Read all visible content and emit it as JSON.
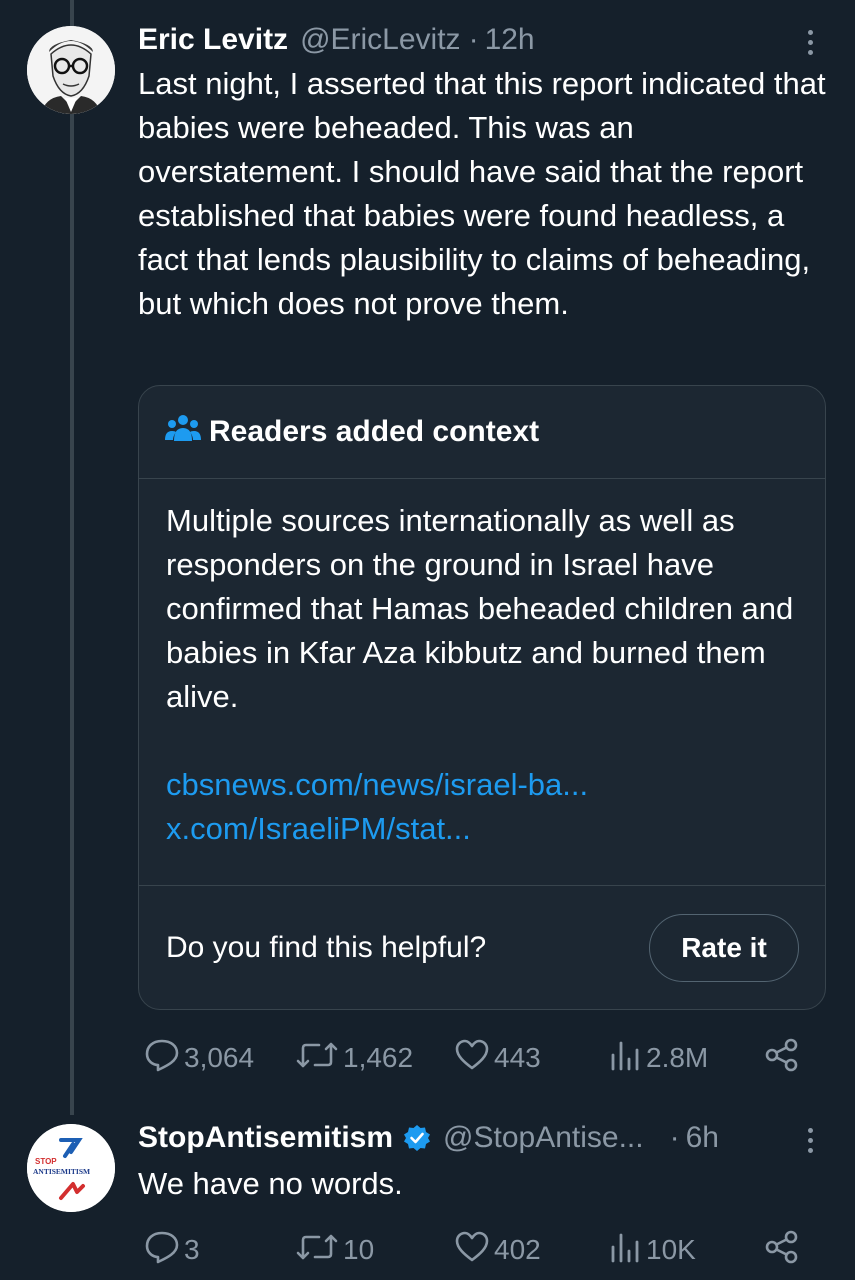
{
  "tweet1": {
    "name": "Eric Levitz",
    "handle": "@EricLevitz",
    "separator": "·",
    "time": "12h",
    "text": "Last night, I asserted that this report indicated that babies were beheaded. This was an overstatement. I should have said that the report established that babies were found headless, a fact that lends plausibility to claims of beheading, but which does not prove them.",
    "note": {
      "title": "Readers added context",
      "body": "Multiple sources internationally as well as responders on the ground in Israel have confirmed that Hamas beheaded children and babies in Kfar Aza kibbutz and burned them alive.",
      "links": [
        "cbsnews.com/news/israel-ba...",
        "x.com/IsraeliPM/stat..."
      ],
      "question": "Do you find this helpful?",
      "rate_label": "Rate it"
    },
    "stats": {
      "replies": "3,064",
      "reposts": "1,462",
      "likes": "443",
      "views": "2.8M"
    }
  },
  "tweet2": {
    "name": "StopAntisemitism",
    "handle": "@StopAntise...",
    "separator": "·",
    "time": "6h",
    "text": "We have no words.",
    "avatar_text": [
      "STOP",
      "ANTISEMITISM"
    ],
    "stats": {
      "replies": "3",
      "reposts": "10",
      "likes": "402",
      "views": "10K"
    }
  },
  "colors": {
    "background": "#15202b",
    "secondary_text": "#8b98a5",
    "link": "#1d9bf0",
    "verified": "#1d9bf0",
    "border": "#38444d"
  },
  "icons": [
    "more-icon",
    "readers-icon",
    "reply-icon",
    "repost-icon",
    "like-icon",
    "views-icon",
    "share-icon",
    "verified-badge-icon"
  ]
}
